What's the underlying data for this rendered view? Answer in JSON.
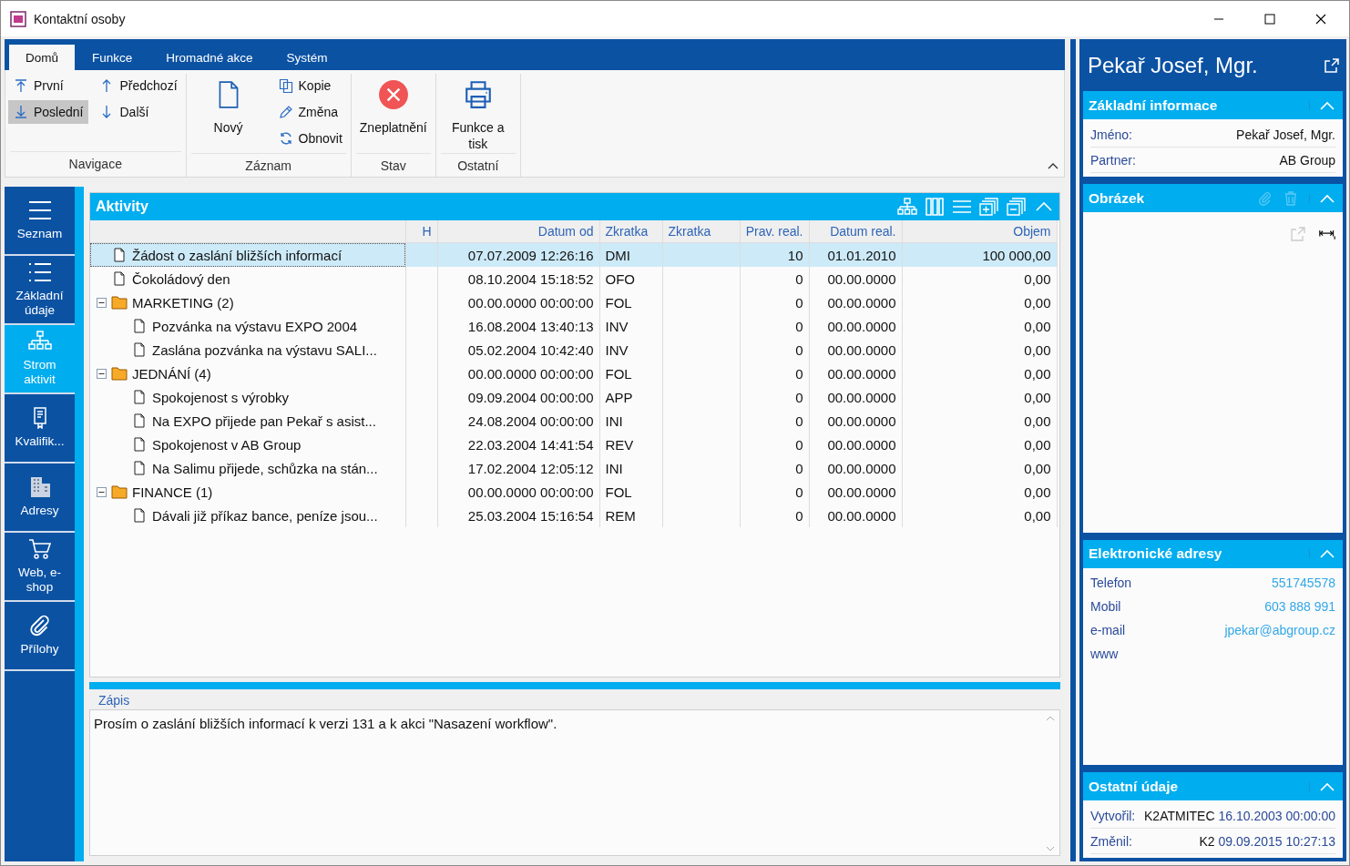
{
  "window": {
    "title": "Kontaktní osoby"
  },
  "ribbon": {
    "tabs": [
      {
        "label": "Domů",
        "selected": true
      },
      {
        "label": "Funkce",
        "selected": false
      },
      {
        "label": "Hromadné akce",
        "selected": false
      },
      {
        "label": "Systém",
        "selected": false
      }
    ],
    "groups": [
      {
        "label": "Navigace",
        "buttons": [
          {
            "label": "První",
            "kind": "small",
            "highlighted": false
          },
          {
            "label": "Poslední",
            "kind": "small",
            "highlighted": true
          },
          {
            "label": "Předchozí",
            "kind": "small",
            "highlighted": false
          },
          {
            "label": "Další",
            "kind": "small",
            "highlighted": false
          }
        ]
      },
      {
        "label": "Záznam",
        "buttons": [
          {
            "label": "Nový",
            "kind": "large"
          },
          {
            "label": "Kopie",
            "kind": "small"
          },
          {
            "label": "Změna",
            "kind": "small"
          },
          {
            "label": "Obnovit",
            "kind": "small"
          }
        ]
      },
      {
        "label": "Stav",
        "buttons": [
          {
            "label": "Zneplatnění",
            "kind": "large"
          }
        ]
      },
      {
        "label": "Ostatní",
        "buttons": [
          {
            "label": "Funkce a tisk",
            "kind": "large"
          }
        ]
      }
    ]
  },
  "sidebar": {
    "items": [
      {
        "label": "Seznam",
        "selected": false
      },
      {
        "label": "Základní údaje",
        "selected": false
      },
      {
        "label": "Strom aktivit",
        "selected": true
      },
      {
        "label": "Kvalifik...",
        "selected": false
      },
      {
        "label": "Adresy",
        "selected": false
      },
      {
        "label": "Web, e-shop",
        "selected": false
      },
      {
        "label": "Přílohy",
        "selected": false
      }
    ]
  },
  "activities": {
    "title": "Aktivity",
    "columns": [
      "H",
      "Datum od",
      "Zkratka",
      "Zkratka",
      "Prav. real.",
      "Datum real.",
      "Objem"
    ],
    "rows": [
      {
        "kind": "document",
        "label": "Žádost o zaslání bližších informací",
        "selected": true,
        "datum_od": "07.07.2009 12:26:16",
        "zkratka": "DMI",
        "prav_real": "10",
        "datum_real": "01.01.2010",
        "objem": "100 000,00"
      },
      {
        "kind": "document",
        "label": "Čokoládový den",
        "selected": false,
        "datum_od": "08.10.2004 15:18:52",
        "zkratka": "OFO",
        "prav_real": "0",
        "datum_real": "00.00.0000",
        "objem": "0,00"
      },
      {
        "kind": "folder",
        "label": "MARKETING (2)",
        "selected": false,
        "expanded": true,
        "datum_od": "00.00.0000 00:00:00",
        "zkratka": "FOL",
        "prav_real": "0",
        "datum_real": "00.00.0000",
        "objem": "0,00",
        "children": [
          {
            "kind": "document",
            "label": "Pozvánka na výstavu EXPO 2004",
            "selected": false,
            "datum_od": "16.08.2004 13:40:13",
            "zkratka": "INV",
            "prav_real": "0",
            "datum_real": "00.00.0000",
            "objem": "0,00"
          },
          {
            "kind": "document",
            "label": "Zaslána pozvánka na výstavu SALI...",
            "selected": false,
            "datum_od": "05.02.2004 10:42:40",
            "zkratka": "INV",
            "prav_real": "0",
            "datum_real": "00.00.0000",
            "objem": "0,00"
          }
        ]
      },
      {
        "kind": "folder",
        "label": "JEDNÁNÍ (4)",
        "selected": false,
        "expanded": true,
        "datum_od": "00.00.0000 00:00:00",
        "zkratka": "FOL",
        "prav_real": "0",
        "datum_real": "00.00.0000",
        "objem": "0,00",
        "children": [
          {
            "kind": "document",
            "label": "Spokojenost s výrobky",
            "selected": false,
            "datum_od": "09.09.2004 00:00:00",
            "zkratka": "APP",
            "prav_real": "0",
            "datum_real": "00.00.0000",
            "objem": "0,00"
          },
          {
            "kind": "document",
            "label": "Na EXPO přijede pan Pekař s asist...",
            "selected": false,
            "datum_od": "24.08.2004 00:00:00",
            "zkratka": "INI",
            "prav_real": "0",
            "datum_real": "00.00.0000",
            "objem": "0,00"
          },
          {
            "kind": "document",
            "label": "Spokojenost v AB Group",
            "selected": false,
            "datum_od": "22.03.2004 14:41:54",
            "zkratka": "REV",
            "prav_real": "0",
            "datum_real": "00.00.0000",
            "objem": "0,00"
          },
          {
            "kind": "document",
            "label": "Na Salimu přijede, schůzka na stán...",
            "selected": false,
            "datum_od": "17.02.2004 12:05:12",
            "zkratka": "INI",
            "prav_real": "0",
            "datum_real": "00.00.0000",
            "objem": "0,00"
          }
        ]
      },
      {
        "kind": "folder",
        "label": "FINANCE (1)",
        "selected": false,
        "expanded": true,
        "datum_od": "00.00.0000 00:00:00",
        "zkratka": "FOL",
        "prav_real": "0",
        "datum_real": "00.00.0000",
        "objem": "0,00",
        "children": [
          {
            "kind": "document",
            "label": "Dávali již příkaz bance, peníze jsou...",
            "selected": false,
            "datum_od": "25.03.2004 15:16:54",
            "zkratka": "REM",
            "prav_real": "0",
            "datum_real": "00.00.0000",
            "objem": "0,00"
          }
        ]
      }
    ]
  },
  "note": {
    "label": "Zápis",
    "text": "Prosím o zaslání bližších informací k verzi 131 a k akci \"Nasazení workflow\"."
  },
  "detail": {
    "title": "Pekař Josef, Mgr.",
    "basic": {
      "title": "Základní informace",
      "expanded": true,
      "fields": [
        {
          "label": "Jméno:",
          "value": "Pekař Josef, Mgr."
        },
        {
          "label": "Partner:",
          "value": "AB Group"
        }
      ]
    },
    "picture": {
      "title": "Obrázek",
      "expanded": true
    },
    "contacts": {
      "title": "Elektronické adresy",
      "expanded": true,
      "fields": [
        {
          "label": "Telefon",
          "value": "551745578"
        },
        {
          "label": "Mobil",
          "value": "603 888 991"
        },
        {
          "label": "e-mail",
          "value": "jpekar@abgroup.cz"
        },
        {
          "label": "www"
        }
      ]
    },
    "other": {
      "title": "Ostatní údaje",
      "expanded": true,
      "fields": [
        {
          "label": "Vytvořil:",
          "user": "K2ATMITEC",
          "date": "16.10.2003 00:00:00"
        },
        {
          "label": "Změnil:",
          "user": "K2",
          "date": "09.09.2015 10:27:13"
        }
      ]
    }
  }
}
